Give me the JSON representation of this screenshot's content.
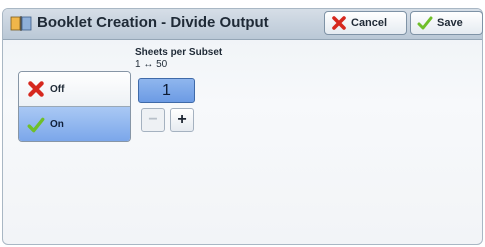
{
  "header": {
    "title": "Booklet Creation - Divide Output",
    "cancel_label": "Cancel",
    "save_label": "Save"
  },
  "divide_output": {
    "options": [
      {
        "label": "Off",
        "icon": "red-x-icon",
        "selected": false
      },
      {
        "label": "On",
        "icon": "green-check-icon",
        "selected": true
      }
    ]
  },
  "sheets_per_subset": {
    "title": "Sheets per Subset",
    "range": "1 ↔ 50",
    "value": "1",
    "minus_label": "−",
    "plus_label": "+"
  },
  "colors": {
    "selected": "#7aa6ea",
    "cancel_icon": "#d6281e",
    "check_icon": "#6fbf2a"
  }
}
